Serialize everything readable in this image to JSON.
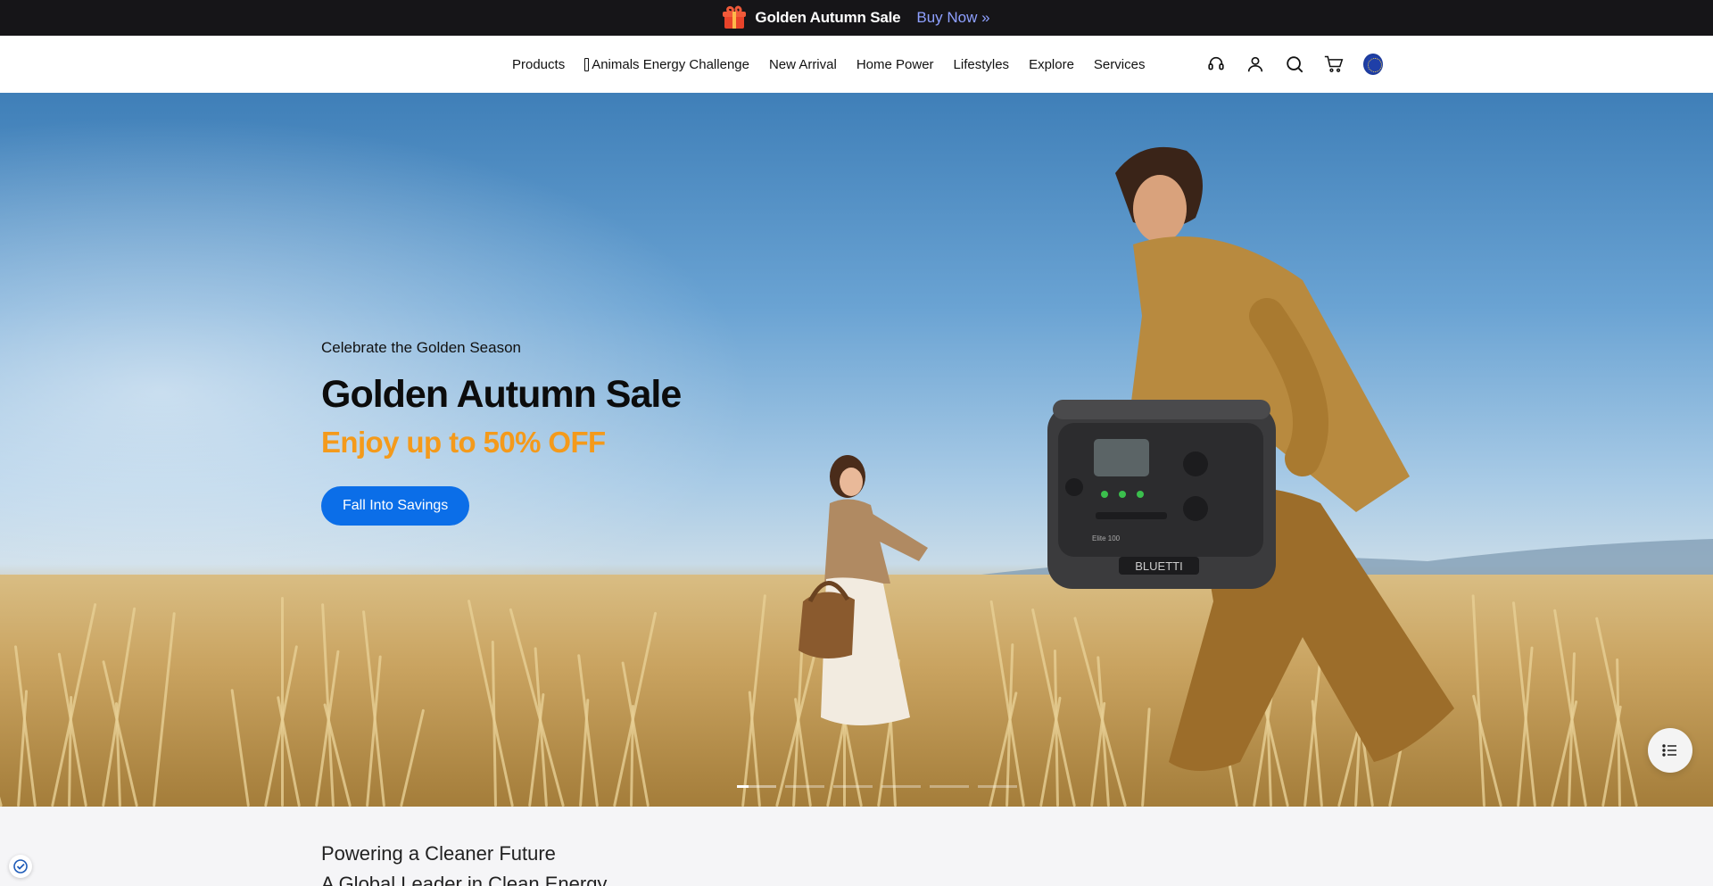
{
  "announcement": {
    "icon": "gift-icon",
    "title": "Golden Autumn Sale",
    "link_label": "Buy Now »"
  },
  "nav": {
    "items": [
      {
        "label": "Products"
      },
      {
        "label": "Animals Energy Challenge",
        "icon": "battery-icon"
      },
      {
        "label": "New Arrival"
      },
      {
        "label": "Home Power"
      },
      {
        "label": "Lifestyles"
      },
      {
        "label": "Explore"
      },
      {
        "label": "Services"
      }
    ],
    "icons": [
      "headset-icon",
      "user-icon",
      "search-icon",
      "cart-icon",
      "globe-icon"
    ]
  },
  "hero": {
    "eyebrow": "Celebrate the Golden Season",
    "headline": "Golden Autumn Sale",
    "subhead": "Enjoy up to 50% OFF",
    "cta_label": "Fall Into Savings",
    "product_badge": "BLUETTI",
    "product_model": "Elite 100",
    "carousel": {
      "total": 6,
      "active_index": 1
    }
  },
  "intro": {
    "line1": "Powering a Cleaner Future",
    "line2": "A Global Leader in Clean Energy"
  },
  "colors": {
    "accent": "#0b6ee8",
    "sale_orange": "#f49a1b",
    "topbar": "#161518"
  }
}
